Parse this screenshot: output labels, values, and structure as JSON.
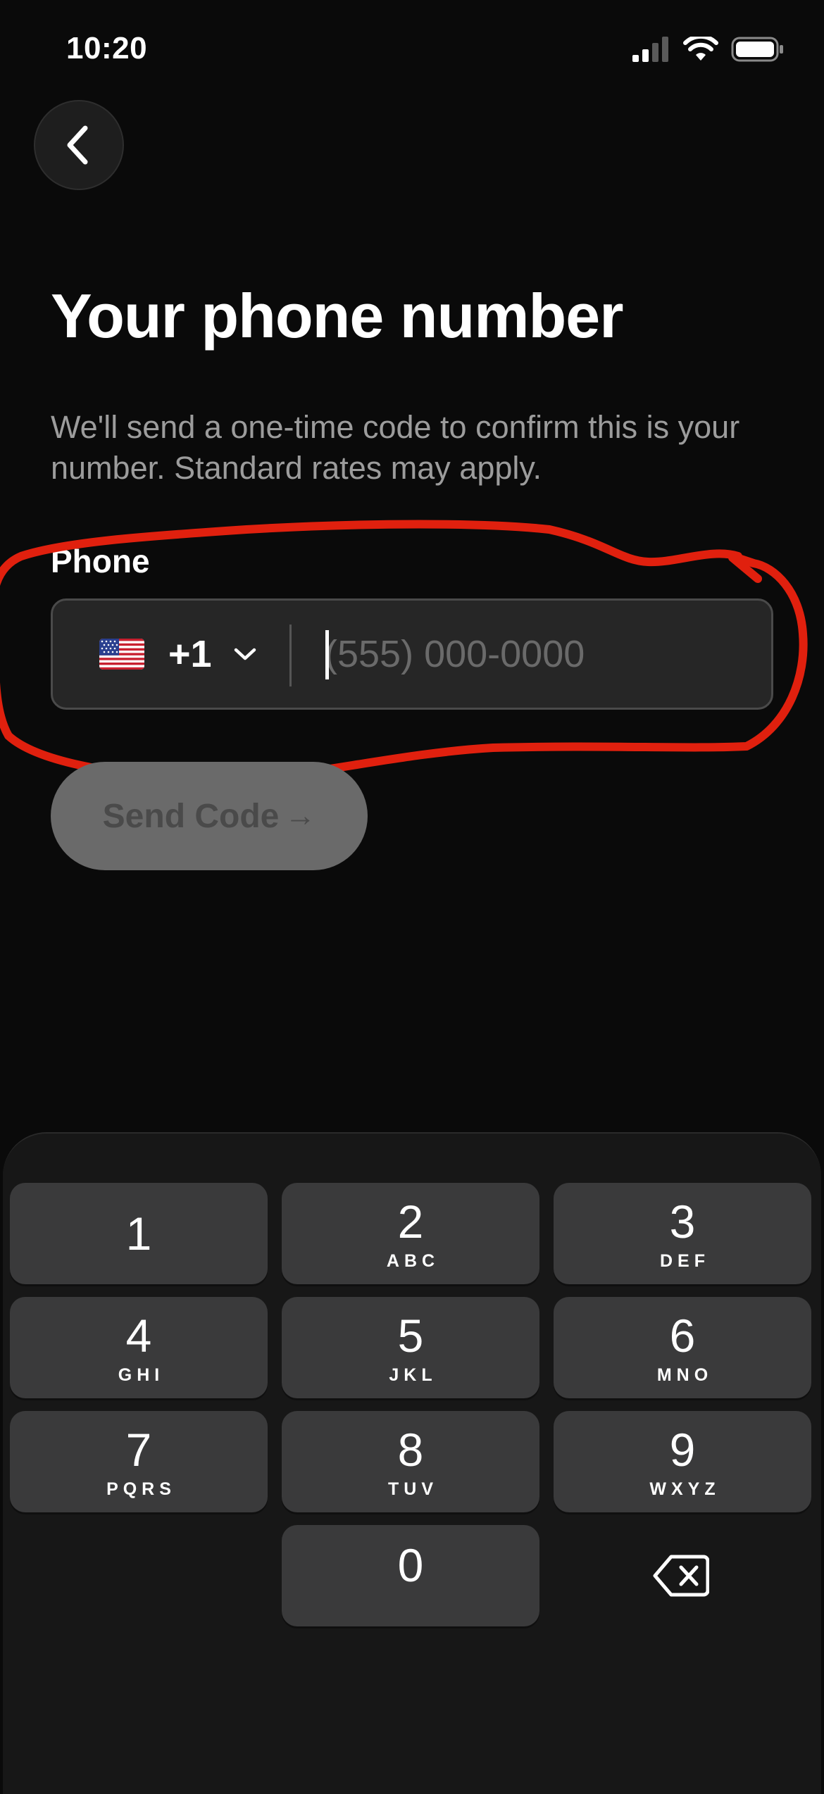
{
  "status_bar": {
    "time": "10:20",
    "icons": [
      "cellular-signal-icon",
      "wifi-icon",
      "battery-icon"
    ]
  },
  "nav": {
    "back_icon": "chevron-left-icon"
  },
  "header": {
    "title": "Your phone number",
    "description": "We'll send a one-time code to confirm this is your number. Standard rates may apply."
  },
  "phone_field": {
    "label": "Phone",
    "country_flag": "us-flag-icon",
    "dial_code": "+1",
    "dropdown_icon": "chevron-down-icon",
    "value": "",
    "placeholder": "(555) 000-0000"
  },
  "send_button": {
    "label": "Send Code",
    "arrow": "→",
    "enabled": false
  },
  "keypad": {
    "keys": [
      {
        "digit": "1",
        "letters": ""
      },
      {
        "digit": "2",
        "letters": "ABC"
      },
      {
        "digit": "3",
        "letters": "DEF"
      },
      {
        "digit": "4",
        "letters": "GHI"
      },
      {
        "digit": "5",
        "letters": "JKL"
      },
      {
        "digit": "6",
        "letters": "MNO"
      },
      {
        "digit": "7",
        "letters": "PQRS"
      },
      {
        "digit": "8",
        "letters": "TUV"
      },
      {
        "digit": "9",
        "letters": "WXYZ"
      },
      {
        "digit": "0",
        "letters": ""
      }
    ],
    "delete_icon": "backspace-icon"
  },
  "colors": {
    "background": "#0a0a0a",
    "field_background": "#262626",
    "button_disabled": "#6a6a6a",
    "key_background": "#3a3a3b",
    "annotation": "#e0200e"
  }
}
